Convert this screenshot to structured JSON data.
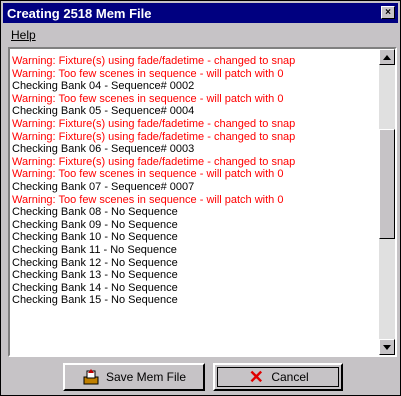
{
  "window": {
    "title": "Creating 2518 Mem File",
    "close_label": "×"
  },
  "menu": {
    "help_label": "Help"
  },
  "log": {
    "lines": [
      {
        "text": "Warning: Fixture(s) using fade/fadetime - changed to snap",
        "kind": "warn"
      },
      {
        "text": "Warning: Too few scenes in sequence - will patch with 0",
        "kind": "warn"
      },
      {
        "text": "Checking Bank 04 - Sequence# 0002",
        "kind": "info"
      },
      {
        "text": "Warning: Too few scenes in sequence - will patch with 0",
        "kind": "warn"
      },
      {
        "text": "Checking Bank 05 - Sequence# 0004",
        "kind": "info"
      },
      {
        "text": "Warning: Fixture(s) using fade/fadetime - changed to snap",
        "kind": "warn"
      },
      {
        "text": "Warning: Fixture(s) using fade/fadetime - changed to snap",
        "kind": "warn"
      },
      {
        "text": "Checking Bank 06 - Sequence# 0003",
        "kind": "info"
      },
      {
        "text": "Warning: Fixture(s) using fade/fadetime - changed to snap",
        "kind": "warn"
      },
      {
        "text": "Warning: Too few scenes in sequence - will patch with 0",
        "kind": "warn"
      },
      {
        "text": "Checking Bank 07 - Sequence# 0007",
        "kind": "info"
      },
      {
        "text": "Warning: Too few scenes in sequence - will patch with 0",
        "kind": "warn"
      },
      {
        "text": "Checking Bank 08 - No Sequence",
        "kind": "info"
      },
      {
        "text": "Checking Bank 09 - No Sequence",
        "kind": "info"
      },
      {
        "text": "Checking Bank 10 - No Sequence",
        "kind": "info"
      },
      {
        "text": "Checking Bank 11 - No Sequence",
        "kind": "info"
      },
      {
        "text": "Checking Bank 12 - No Sequence",
        "kind": "info"
      },
      {
        "text": "Checking Bank 13 - No Sequence",
        "kind": "info"
      },
      {
        "text": "Checking Bank 14 - No Sequence",
        "kind": "info"
      },
      {
        "text": "Checking Bank 15 - No Sequence",
        "kind": "info"
      }
    ]
  },
  "buttons": {
    "save_label": "Save Mem File",
    "cancel_label": "Cancel"
  },
  "icons": {
    "save": "save-disk-icon",
    "cancel": "cancel-x-icon",
    "scroll_up": "scroll-up-arrow-icon",
    "scroll_down": "scroll-down-arrow-icon"
  },
  "colors": {
    "warning": "#ff0000",
    "info": "#000000",
    "titlebar": "#000080"
  }
}
